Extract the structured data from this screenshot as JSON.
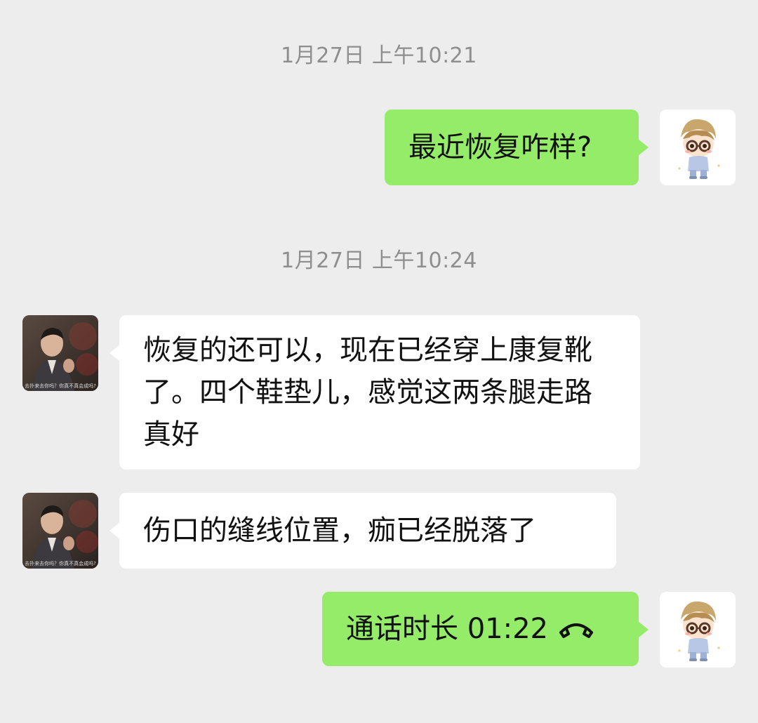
{
  "messages": [
    {
      "time": "1月27日 上午10:21"
    },
    {
      "sender": "me",
      "text": "最近恢复咋样?"
    },
    {
      "time": "1月27日 上午10:24"
    },
    {
      "sender": "other",
      "text": "恢复的还可以，现在已经穿上康复靴了。四个鞋垫儿，感觉这两条腿走路真好"
    },
    {
      "sender": "other",
      "text": "伤口的缝线位置，痂已经脱落了"
    },
    {
      "sender": "me",
      "call_label": "通话时长 01:22",
      "icon": "hangup-phone-icon"
    }
  ],
  "avatars": {
    "me": {
      "icon": "cartoon-boy-avatar"
    },
    "other": {
      "icon": "man-photo-avatar",
      "caption": "去扑来去你吗？你真不真会成吗?"
    }
  },
  "colors": {
    "background": "#ededed",
    "outgoing_bubble": "#95ec69",
    "incoming_bubble": "#ffffff",
    "timestamp_text": "#8e8e8e"
  }
}
